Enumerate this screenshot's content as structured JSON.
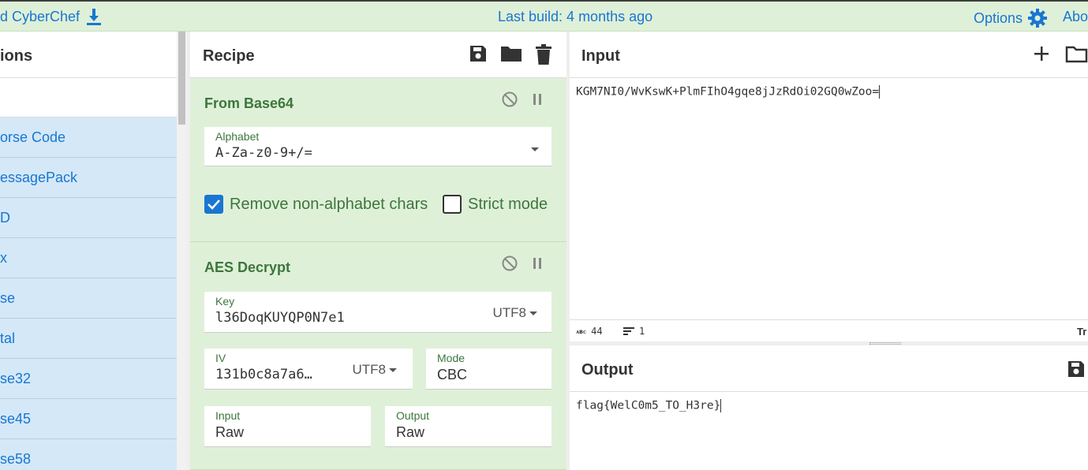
{
  "banner": {
    "download_label": "d CyberChef",
    "last_build": "Last build: 4 months ago",
    "options_label": "Options",
    "about_label": "Abo"
  },
  "operations": {
    "title": "ions",
    "items": [
      "orse Code",
      "essagePack",
      "D",
      "x",
      "se",
      "tal",
      "se32",
      "se45",
      "se58"
    ]
  },
  "recipe": {
    "title": "Recipe",
    "from_base64": {
      "title": "From Base64",
      "alphabet_label": "Alphabet",
      "alphabet_value": "A-Za-z0-9+/=",
      "remove_nonalpha_label": "Remove non-alphabet chars",
      "strict_mode_label": "Strict mode"
    },
    "aes_decrypt": {
      "title": "AES Decrypt",
      "key_label": "Key",
      "key_value": "l36DoqKUYQP0N7e1",
      "key_encoding": "UTF8",
      "iv_label": "IV",
      "iv_value": "131b0c8a7a6…",
      "iv_encoding": "UTF8",
      "mode_label": "Mode",
      "mode_value": "CBC",
      "input_label": "Input",
      "input_value": "Raw",
      "output_label": "Output",
      "output_value": "Raw"
    }
  },
  "input": {
    "title": "Input",
    "text": "KGM7NI0/WvKswK+PlmFIhO4gqe8jJzRdOi02GQ0wZoo=",
    "char_count": "44",
    "line_count": "1",
    "status_right": "Tr"
  },
  "output": {
    "title": "Output",
    "text": "flag{WelC0m5_TO_H3re}"
  },
  "colors": {
    "banner_bg": "#dff0d8",
    "link_blue": "#1976d2",
    "op_bg": "#dff0d8",
    "op_title_green": "#3c763d",
    "ops_list_bg": "#d4e8f7"
  }
}
